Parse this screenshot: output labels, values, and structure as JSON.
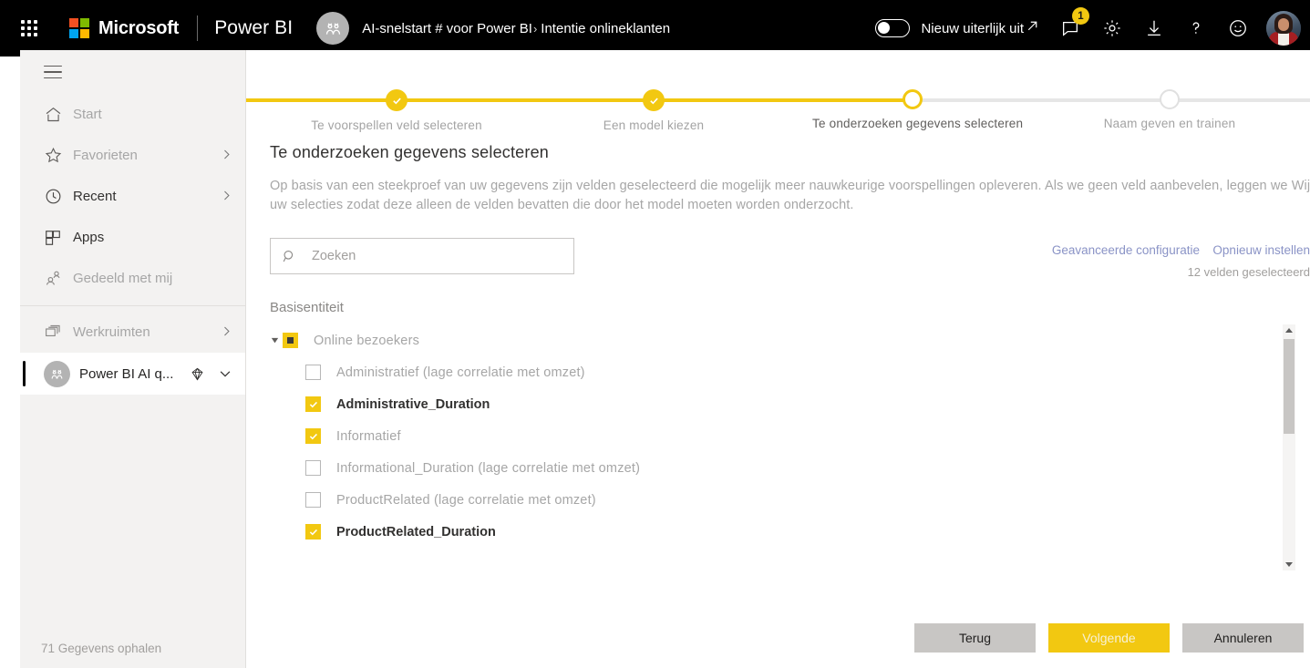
{
  "topbar": {
    "waffle_icon": "app-launcher-icon",
    "brand": "Microsoft",
    "product": "Power BI",
    "breadcrumb": {
      "app_icon": "ai-quickstart-avatar",
      "parent": "AI-snelstart # voor Power BI",
      "separator": "›",
      "current": "Intentie onlineklanten"
    },
    "new_look_toggle": {
      "label": "Nieuw uiterlijk uit",
      "state": "off",
      "arrow": "↗"
    },
    "icons": [
      {
        "name": "notifications-icon",
        "badge": "1"
      },
      {
        "name": "settings-gear-icon",
        "badge": ""
      },
      {
        "name": "download-icon",
        "badge": ""
      },
      {
        "name": "help-question-icon",
        "badge": ""
      },
      {
        "name": "feedback-smiley-icon",
        "badge": ""
      }
    ],
    "account_avatar": "user-profile-photo"
  },
  "sidebar": {
    "hamburger_icon": "hamburger-menu-icon",
    "items": [
      {
        "label": "Start",
        "icon": "home-icon",
        "chevron": false,
        "dim": true
      },
      {
        "label": "Favorieten",
        "icon": "star-icon",
        "chevron": true,
        "dim": true
      },
      {
        "label": "Recent",
        "icon": "clock-icon",
        "chevron": true,
        "dim": false
      },
      {
        "label": "Apps",
        "icon": "apps-grid-icon",
        "chevron": false,
        "dim": false
      },
      {
        "label": "Gedeeld met mij",
        "icon": "shared-people-icon",
        "chevron": false,
        "dim": true
      }
    ],
    "workspaces": {
      "label": "Werkruimten",
      "icon": "workspaces-icon",
      "chevron": true
    },
    "current_workspace": {
      "name": "Power BI AI q...",
      "avatar": "workspace-avatar",
      "premium_icon": "diamond-icon",
      "chevron_icon": "chevron-down-icon"
    },
    "footer_status": "71 Gegevens ophalen"
  },
  "stepper": {
    "steps": [
      {
        "label": "Te voorspellen veld selecteren",
        "state": "done"
      },
      {
        "label": "Een model kiezen",
        "state": "done"
      },
      {
        "label": "Te onderzoeken gegevens selecteren",
        "state": "current"
      },
      {
        "label": "Naam geven en trainen",
        "state": "future"
      }
    ],
    "accent_color": "#f2c811",
    "track_color": "#e6e6e6"
  },
  "page": {
    "title": "Te onderzoeken gegevens selecteren",
    "description": "Op basis van een steekproef van uw gegevens zijn velden geselecteerd die mogelijk meer nauwkeurige voorspellingen opleveren. Als we geen veld aanbevelen, leggen we Wijzig uw selecties zodat deze alleen de velden bevatten die door het model moeten worden onderzocht."
  },
  "search": {
    "placeholder": "Zoeken",
    "value": "",
    "icon": "search-icon"
  },
  "right_links": {
    "advanced": "Geavanceerde configuratie",
    "reset": "Opnieuw instellen",
    "selected_count": "12 velden geselecteerd"
  },
  "fields": {
    "section_label": "Basisentiteit",
    "root": {
      "label": "Online bezoekers",
      "state": "partial",
      "expanded": true,
      "caret_icon": "caret-down-icon"
    },
    "items": [
      {
        "label": "Administratief (lage correlatie met omzet)",
        "checked": false,
        "emphasis": false
      },
      {
        "label": "Administrative_Duration",
        "checked": true,
        "emphasis": true
      },
      {
        "label": "Informatief",
        "checked": true,
        "emphasis": false
      },
      {
        "label": "Informational_Duration (lage correlatie met omzet)",
        "checked": false,
        "emphasis": false
      },
      {
        "label": "ProductRelated (lage correlatie met omzet)",
        "checked": false,
        "emphasis": false
      },
      {
        "label": "ProductRelated_Duration",
        "checked": true,
        "emphasis": true
      }
    ]
  },
  "scrollbar": {
    "up_icon": "scroll-up-arrow-icon",
    "down_icon": "scroll-down-arrow-icon",
    "thumb": "scroll-thumb"
  },
  "footer": {
    "back": "Terug",
    "next": "Volgende",
    "cancel": "Annuleren"
  }
}
